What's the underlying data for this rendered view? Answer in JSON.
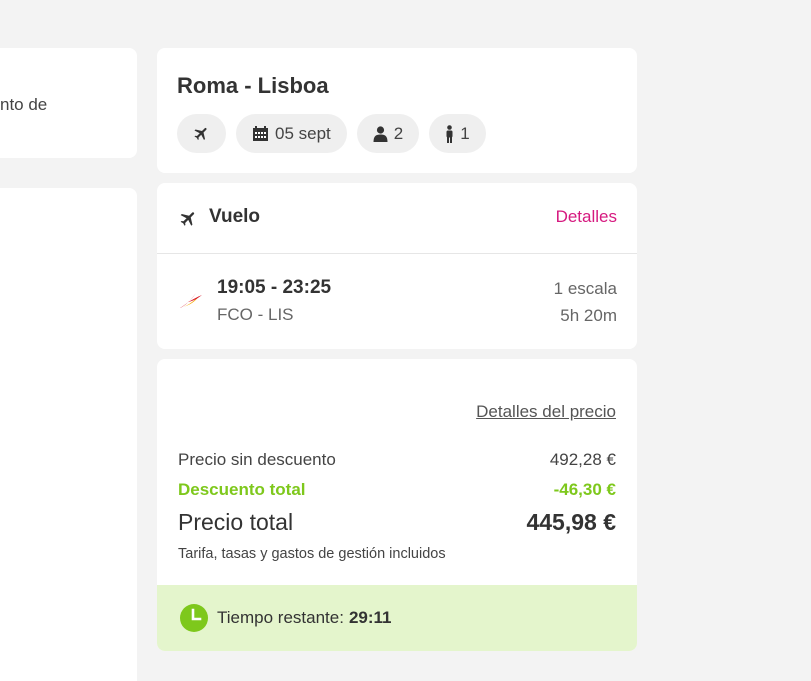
{
  "left_panel": {
    "snippet_text": "nto de"
  },
  "route": {
    "title": "Roma - Lisboa",
    "chips": {
      "date": "05 sept",
      "adults": "2",
      "children": "1"
    }
  },
  "flight": {
    "section_title": "Vuelo",
    "details_link": "Detalles",
    "times": "19:05 - 23:25",
    "route": "FCO  - LIS",
    "stops": "1 escala",
    "duration": "5h 20m"
  },
  "price": {
    "details_link": "Detalles del precio",
    "no_discount_label": "Precio sin descuento",
    "no_discount_value": "492,28 €",
    "discount_label": "Descuento total",
    "discount_value": "-46,30 €",
    "total_label": "Precio total",
    "total_value": "445,98 €",
    "note": "Tarifa, tasas y gastos de gestión incluidos"
  },
  "timer": {
    "label": "Tiempo restante:",
    "value": "29:11"
  },
  "colors": {
    "link_pink": "#d6197f",
    "discount_green": "#7ec81c",
    "timer_bg": "#e4f5cc",
    "page_bg": "#f3f3f3"
  }
}
